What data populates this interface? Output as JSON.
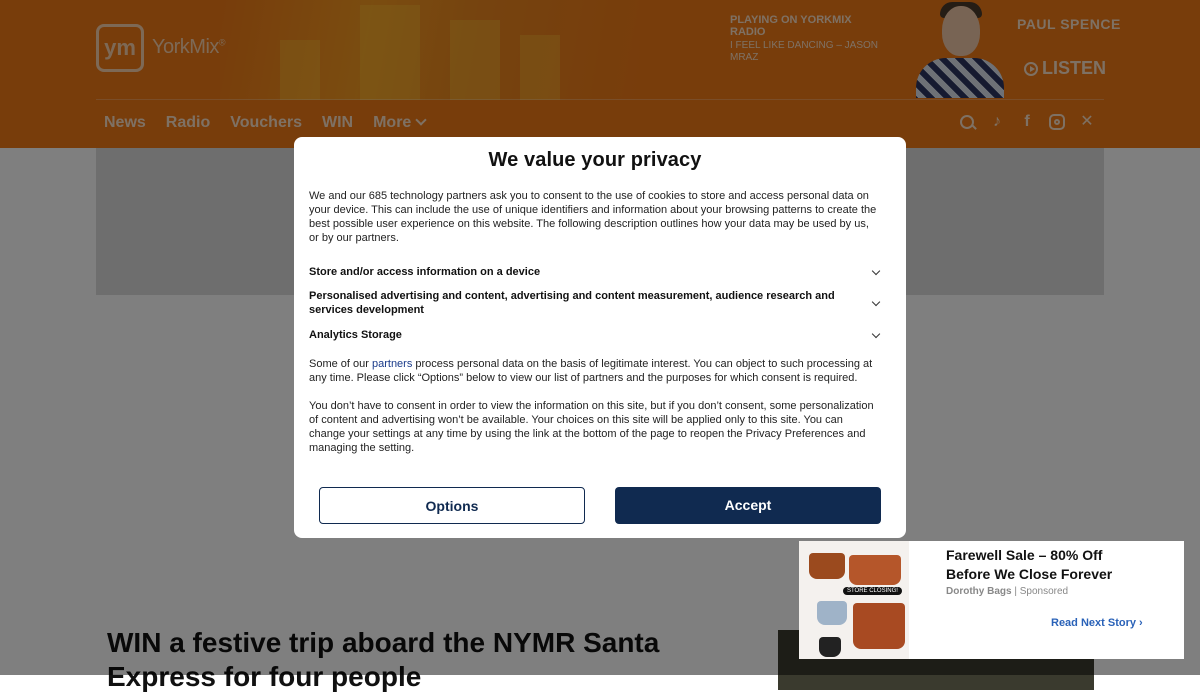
{
  "header": {
    "logo_mark": "ym",
    "logo_text": "YorkMix",
    "logo_reg": "®",
    "now_playing_title": "PLAYING ON YORKMIX RADIO",
    "now_playing_song": "I FEEL LIKE DANCING – JASON MRAZ",
    "presenter_name": "PAUL SPENCE",
    "listen_label": "LISTEN",
    "nav": [
      "News",
      "Radio",
      "Vouchers",
      "WIN",
      "More"
    ],
    "social_icons": [
      "search-icon",
      "tiktok-icon",
      "facebook-icon",
      "instagram-icon",
      "x-icon"
    ]
  },
  "article": {
    "headline": "WIN a festive trip aboard the NYMR Santa Express for four people"
  },
  "consent": {
    "title": "We value your privacy",
    "intro": "We and our 685 technology partners ask you to consent to the use of cookies to store and access personal data on your device. This can include the use of unique identifiers and information about your browsing patterns to create the best possible user experience on this website. The following description outlines how your data may be used by us, or by our partners.",
    "purposes": [
      "Store and/or access information on a device",
      "Personalised advertising and content, advertising and content measurement, audience research and services development",
      "Analytics Storage"
    ],
    "legit_pre": "Some of our ",
    "legit_link": "partners",
    "legit_post": " process personal data on the basis of legitimate interest. You can object to such processing at any time. Please click “Options” below to view our list of partners and the purposes for which consent is required.",
    "no_consent": "You don’t have to consent in order to view the information on this site, but if you don’t consent, some personalization of content and advertising won’t be available. Your choices on this site will be applied only to this site. You can change your settings at any time by using the link at the bottom of the page to reopen the Privacy Preferences and managing the setting.",
    "options_label": "Options",
    "accept_label": "Accept"
  },
  "sponsored": {
    "title": "Farewell Sale – 80% Off Before We Close Forever",
    "source": "Dorothy Bags",
    "label": "Sponsored",
    "image_tag": "STORE CLOSING!",
    "next_label": "Read Next Story ›"
  },
  "colors": {
    "header_bg": "#f07a17",
    "accept_bg": "#102a50",
    "link": "#2a62b8"
  }
}
